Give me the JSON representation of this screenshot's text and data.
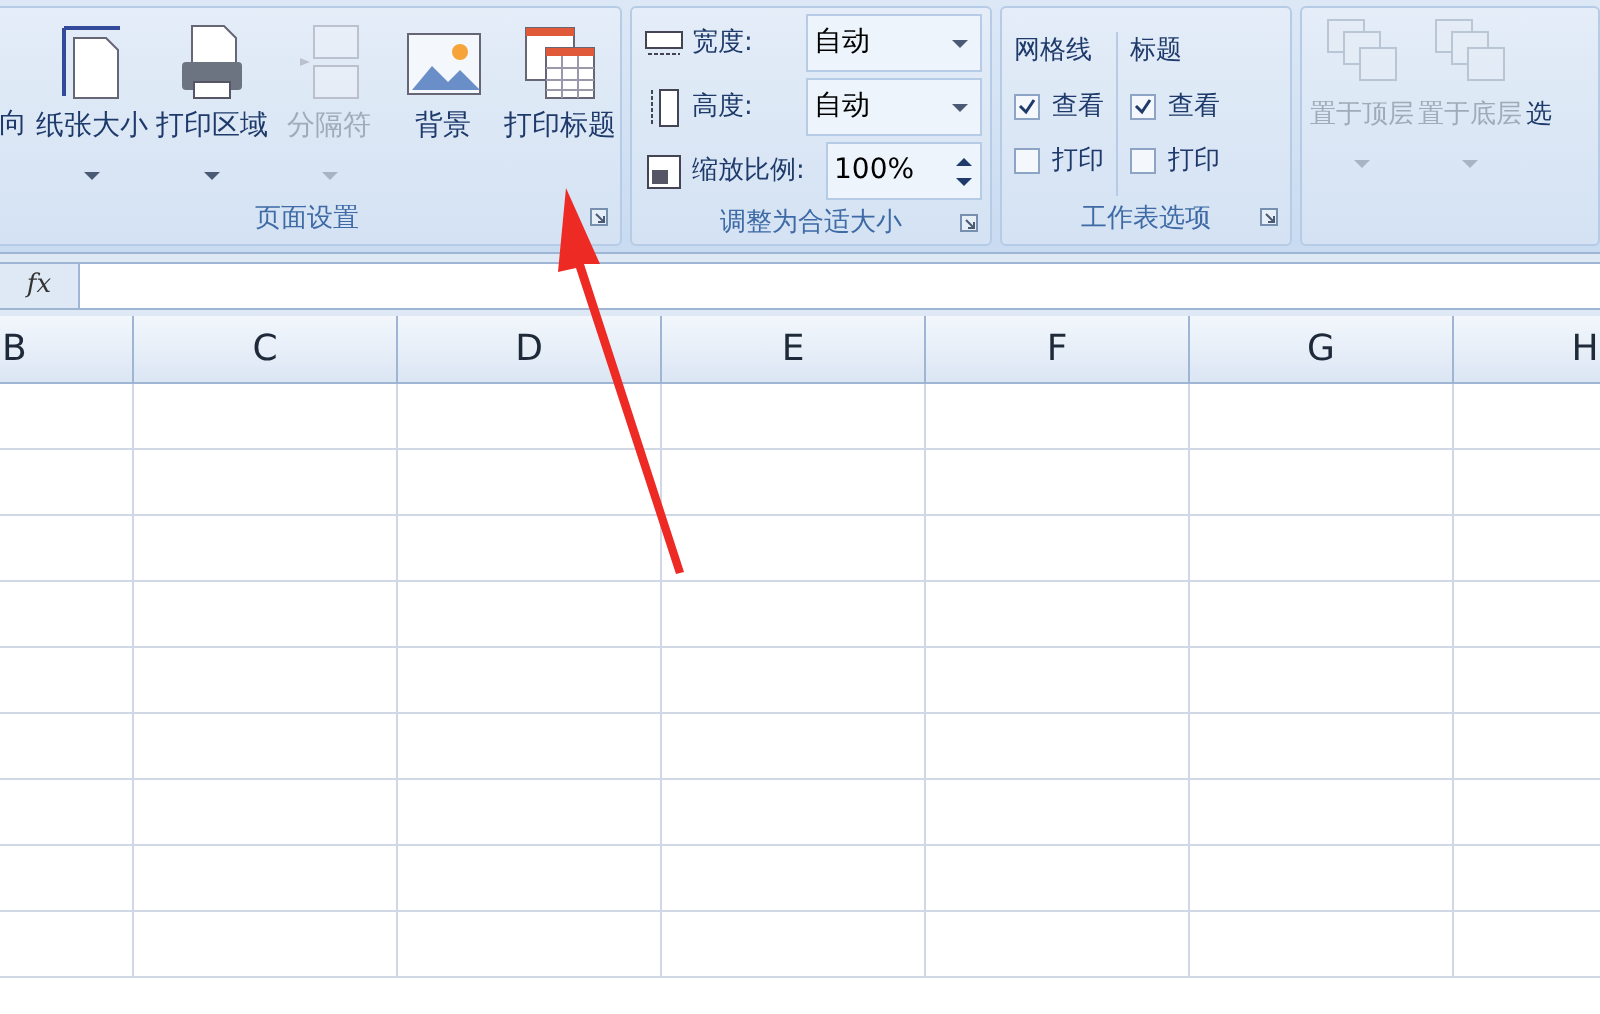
{
  "ribbon": {
    "page_setup": {
      "label": "页面设置",
      "buttons": [
        {
          "kind": "cut",
          "label": "向",
          "disabled": false,
          "dropdown": false
        },
        {
          "kind": "paper",
          "label": "纸张大小",
          "disabled": false,
          "dropdown": true
        },
        {
          "kind": "print-area",
          "label": "打印区域",
          "disabled": false,
          "dropdown": true
        },
        {
          "kind": "breaks",
          "label": "分隔符",
          "disabled": true,
          "dropdown": true
        },
        {
          "kind": "background",
          "label": "背景",
          "disabled": false,
          "dropdown": false
        },
        {
          "kind": "print-titles",
          "label": "打印标题",
          "disabled": false,
          "dropdown": false
        }
      ]
    },
    "scale_to_fit": {
      "label": "调整为合适大小",
      "rows": [
        {
          "kind": "width",
          "label": "宽度:",
          "value": "自动"
        },
        {
          "kind": "height",
          "label": "高度:",
          "value": "自动"
        },
        {
          "kind": "scale",
          "label": "缩放比例:",
          "value": "100%"
        }
      ]
    },
    "sheet_options": {
      "label": "工作表选项",
      "columns": [
        {
          "title": "网格线",
          "options": [
            {
              "label": "查看",
              "checked": true
            },
            {
              "label": "打印",
              "checked": false
            }
          ]
        },
        {
          "title": "标题",
          "options": [
            {
              "label": "查看",
              "checked": true
            },
            {
              "label": "打印",
              "checked": false
            }
          ]
        }
      ]
    },
    "arrange": {
      "buttons": [
        {
          "label": "置于顶层",
          "disabled": true
        },
        {
          "label": "置于底层",
          "disabled": true
        },
        {
          "label": "选",
          "disabled": false
        }
      ]
    }
  },
  "formula_bar": {
    "function_button": "fx"
  },
  "columns": [
    "B",
    "C",
    "D",
    "E",
    "F",
    "G",
    "H"
  ]
}
